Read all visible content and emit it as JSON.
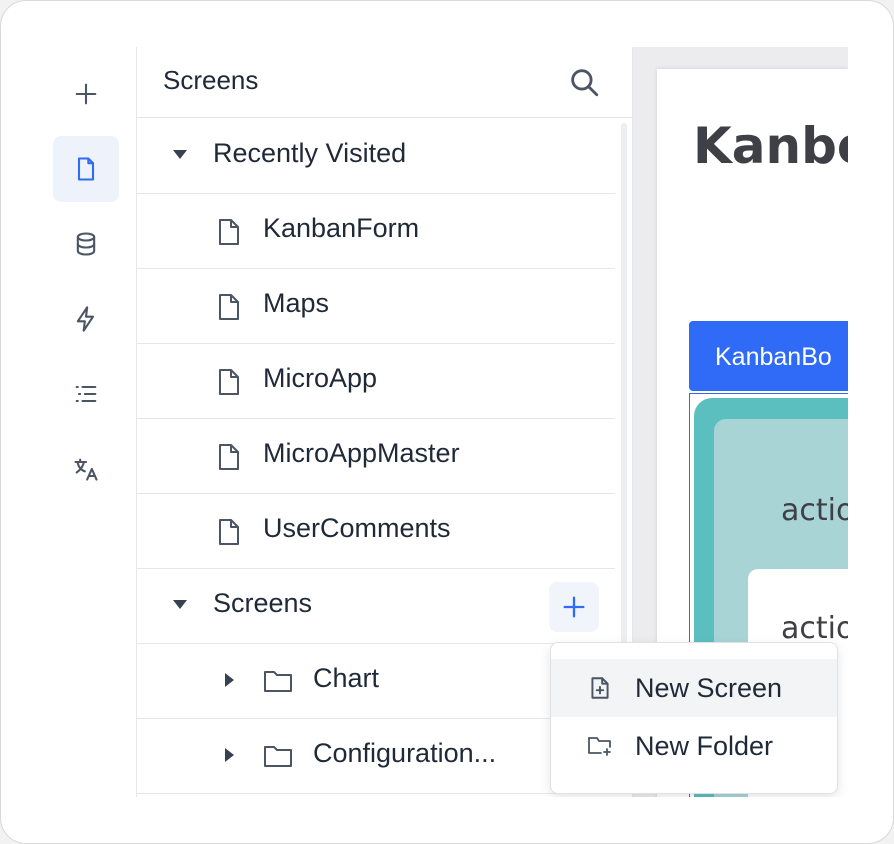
{
  "rail": {
    "items": [
      {
        "icon": "plus-icon",
        "active": false
      },
      {
        "icon": "file-icon",
        "active": true
      },
      {
        "icon": "database-icon",
        "active": false
      },
      {
        "icon": "lightning-icon",
        "active": false
      },
      {
        "icon": "list-icon",
        "active": false
      },
      {
        "icon": "translate-icon",
        "active": false
      }
    ]
  },
  "panel": {
    "title": "Screens",
    "search_icon": "search-icon",
    "recent_group": "Recently Visited",
    "recent_items": [
      "KanbanForm",
      "Maps",
      "MicroApp",
      "MicroAppMaster",
      "UserComments"
    ],
    "screens_group": "Screens",
    "folders": [
      "Chart",
      "Configuration..."
    ]
  },
  "menu": {
    "items": [
      {
        "label": "New Screen",
        "icon": "new-screen-icon"
      },
      {
        "label": "New Folder",
        "icon": "new-folder-icon"
      }
    ]
  },
  "canvas": {
    "title": "Kanbo",
    "kanban_header": "KanbanBo",
    "card_label_1": "actio",
    "card_label_2": "actio"
  },
  "colors": {
    "accent": "#2f6bf6",
    "teal": "#5cbfbf",
    "teal_light": "#a8d4d6"
  }
}
